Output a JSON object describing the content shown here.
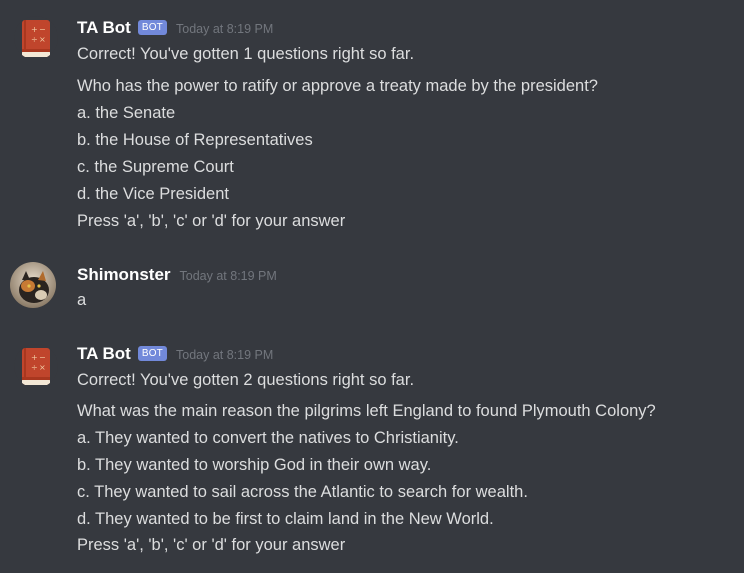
{
  "messages": [
    {
      "author": "TA Bot",
      "badge": "BOT",
      "timestamp": "Today at 8:19 PM",
      "avatar_icon": "book-icon",
      "lines": [
        "Correct! You've gotten 1 questions right so far.",
        "Who has the power to ratify or approve a treaty made by the president?",
        "a. the Senate",
        "b. the House of Representatives",
        "c. the Supreme Court",
        "d. the Vice President",
        "Press 'a', 'b', 'c' or 'd' for your answer"
      ]
    },
    {
      "author": "Shimonster",
      "timestamp": "Today at 8:19 PM",
      "avatar_icon": "cat-photo-icon",
      "lines": [
        "a"
      ]
    },
    {
      "author": "TA Bot",
      "badge": "BOT",
      "timestamp": "Today at 8:19 PM",
      "avatar_icon": "book-icon",
      "lines": [
        "Correct! You've gotten 2 questions right so far.",
        "What was the main reason the pilgrims left England to found Plymouth Colony?",
        "a. They wanted to convert the natives to Christianity.",
        "b. They wanted to worship God in their own way.",
        "c. They wanted to sail across the Atlantic to search for wealth.",
        "d. They wanted to be first to claim land in the New World.",
        "Press 'a', 'b', 'c' or 'd' for your answer"
      ]
    }
  ],
  "colors": {
    "background": "#36393f",
    "bot_badge": "#7289da",
    "book_cover": "#c0452c",
    "timestamp": "#72767d"
  }
}
